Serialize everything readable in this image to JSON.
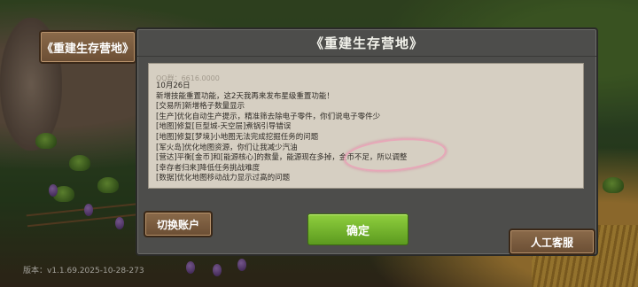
{
  "side_title_button": "《重建生存营地》",
  "dialog": {
    "title": "《重建生存营地》",
    "partial_top_line": "QQ群：6616.0000",
    "notes": [
      "10月26日",
      "新增技能重置功能，这2天我再来发布星级重置功能！",
      "[交易所]新增格子数量显示",
      "[生产]优化自动生产提示，精准筛去除电子零件，你们说电子零件少",
      "[地图]修复[巨型城-天空层]煮锅引导错误",
      "[地图]修复[梦境]小地图无法完成挖掘任务的问题",
      "[军火岛]优化地图资源，你们让我减少汽油",
      "[营达]平衡[金币]和[能源核心]的数量，能源现在多掉，金币不足，所以调整",
      "[幸存者归来]降低任务挑战难度",
      "[数据]优化地图移动战力显示过高的问题"
    ],
    "confirm_label": "确定"
  },
  "switch_account_label": "切换账户",
  "support_label": "人工客服",
  "version_text": "版本：v1.1.69.2025-10-28-273",
  "colors": {
    "confirm": "#6fb02a",
    "dialog_bg": "#4d4d4b",
    "content_bg": "#d6cfc2",
    "highlight_circle": "#e7a7b8"
  }
}
